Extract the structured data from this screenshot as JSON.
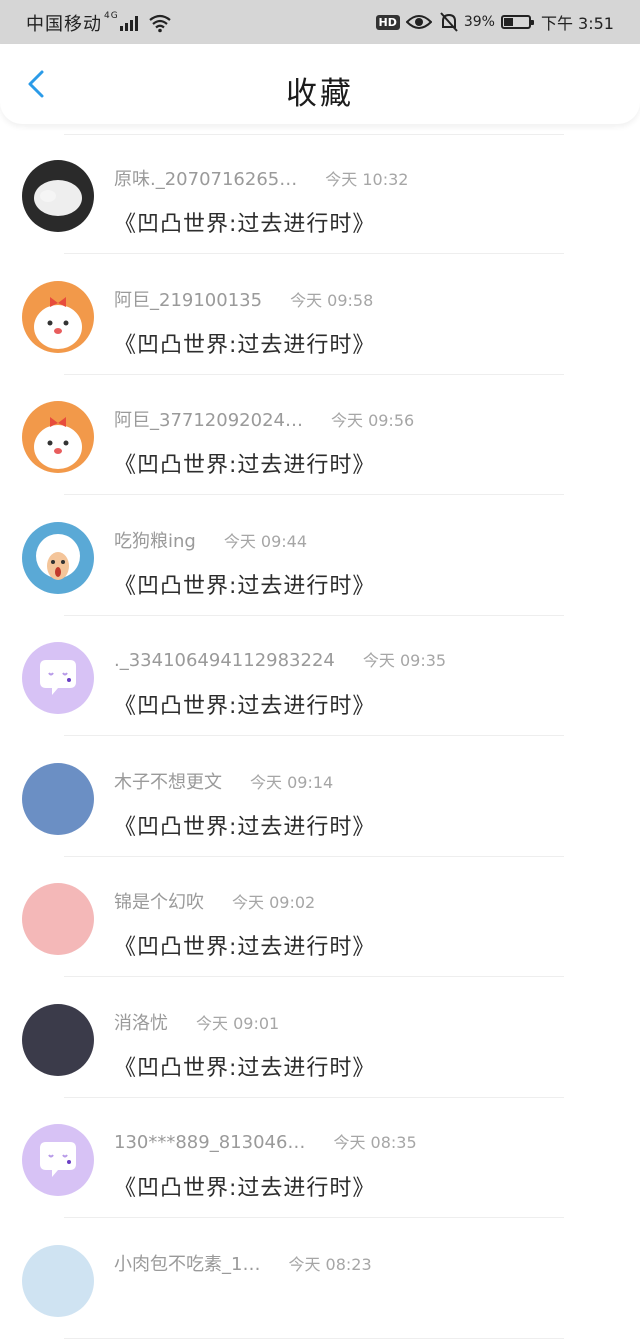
{
  "status_bar": {
    "carrier": "中国移动",
    "network": "4G",
    "hd": "HD",
    "battery": "39%",
    "battery_level": 0.39,
    "time": "下午 3:51"
  },
  "header": {
    "title": "收藏"
  },
  "favorites": [
    {
      "username": "原味._2070716265…",
      "time": "今天 10:32",
      "book": "《凹凸世界:过去进行时》",
      "avatar_color": "#2a2a2a"
    },
    {
      "username": "阿巨_219100135",
      "time": "今天 09:58",
      "book": "《凹凸世界:过去进行时》",
      "avatar_color": "#f2994a"
    },
    {
      "username": "阿巨_37712092024…",
      "time": "今天 09:56",
      "book": "《凹凸世界:过去进行时》",
      "avatar_color": "#f2994a"
    },
    {
      "username": "吃狗粮ing",
      "time": "今天 09:44",
      "book": "《凹凸世界:过去进行时》",
      "avatar_color": "#5aa9d6"
    },
    {
      "username": "._334106494112983224",
      "time": "今天 09:35",
      "book": "《凹凸世界:过去进行时》",
      "avatar_color": "#d7c2f5"
    },
    {
      "username": "木子不想更文",
      "time": "今天 09:14",
      "book": "《凹凸世界:过去进行时》",
      "avatar_color": "#6b8fc4"
    },
    {
      "username": "锦是个幻吹",
      "time": "今天 09:02",
      "book": "《凹凸世界:过去进行时》",
      "avatar_color": "#f4b8b8"
    },
    {
      "username": "消洛忧",
      "time": "今天 09:01",
      "book": "《凹凸世界:过去进行时》",
      "avatar_color": "#3b3b4a"
    },
    {
      "username": "130***889_813046…",
      "time": "今天 08:35",
      "book": "《凹凸世界:过去进行时》",
      "avatar_color": "#d7c2f5"
    },
    {
      "username": "小肉包不吃素_1…",
      "time": "今天 08:23",
      "book": "",
      "avatar_color": "#cfe3f2"
    }
  ]
}
